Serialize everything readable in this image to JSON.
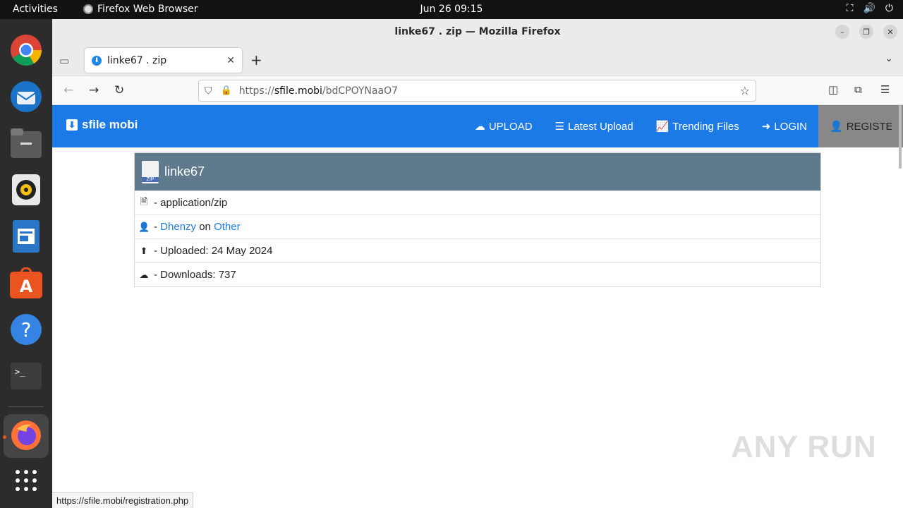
{
  "topbar": {
    "activities": "Activities",
    "app_name": "Firefox Web Browser",
    "clock": "Jun 26  09:15"
  },
  "dock": {
    "apps": [
      "Google Chrome",
      "Thunderbird",
      "Files",
      "Rhythmbox",
      "LibreOffice Writer",
      "Ubuntu Software",
      "Help",
      "Terminal",
      "Firefox",
      "Show Applications"
    ]
  },
  "window": {
    "title": "linke67 . zip — Mozilla Firefox"
  },
  "tab": {
    "label": "linke67 . zip"
  },
  "urlbar": {
    "prefix": "https://",
    "domain": "sfile.mobi",
    "path": "/bdCPOYNaaO7"
  },
  "site": {
    "brand": "sfile mobi",
    "nav": {
      "upload": "UPLOAD",
      "latest": "Latest Upload",
      "trending": "Trending Files",
      "login": "LOGIN",
      "register": "REGISTER"
    }
  },
  "file": {
    "name": "linke67",
    "zip_badge": "ZIP",
    "mime": "- application/zip",
    "dash": "-",
    "uploader": "Dhenzy",
    "on_word": "on",
    "category": "Other",
    "uploaded": "- Uploaded: 24 May 2024",
    "downloads": "- Downloads: 737"
  },
  "watermark": "ANY RUN",
  "status_url": "https://sfile.mobi/registration.php",
  "colors": {
    "site_nav": "#1b7ae6",
    "card_header": "#5e7a8c",
    "link": "#1b7ae6",
    "register_bg": "#888888"
  }
}
